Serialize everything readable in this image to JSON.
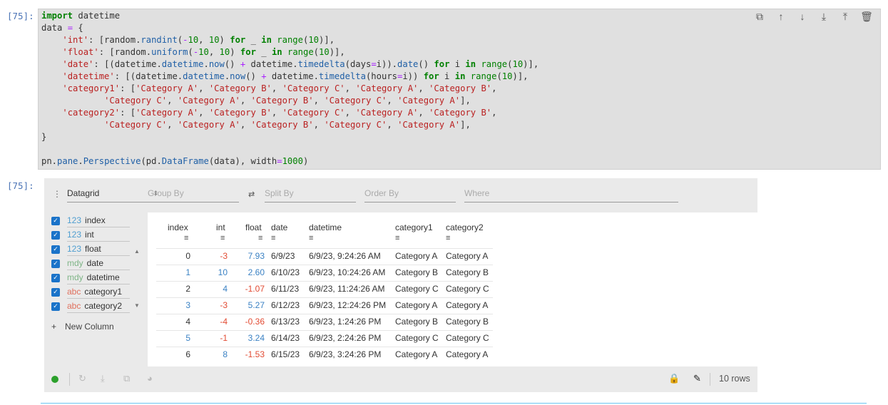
{
  "notebook": {
    "in_prompt": "[75]:",
    "out_prompt": "[75]:",
    "cell_toolbar": [
      {
        "name": "duplicate-icon",
        "glyph": "⧉"
      },
      {
        "name": "move-up-icon",
        "glyph": "↑"
      },
      {
        "name": "move-down-icon",
        "glyph": "↓"
      },
      {
        "name": "insert-below-icon",
        "glyph": "⤓"
      },
      {
        "name": "insert-above-icon",
        "glyph": "⤒"
      },
      {
        "name": "delete-icon",
        "glyph": "🗑"
      }
    ],
    "code_lines": [
      "import datetime",
      "data = {",
      "    'int': [random.randint(-10, 10) for _ in range(10)],",
      "    'float': [random.uniform(-10, 10) for _ in range(10)],",
      "    'date': [(datetime.datetime.now() + datetime.timedelta(days=i)).date() for i in range(10)],",
      "    'datetime': [(datetime.datetime.now() + datetime.timedelta(hours=i)) for i in range(10)],",
      "    'category1': ['Category A', 'Category B', 'Category C', 'Category A', 'Category B',",
      "            'Category C', 'Category A', 'Category B', 'Category C', 'Category A'],",
      "    'category2': ['Category A', 'Category B', 'Category C', 'Category A', 'Category B',",
      "            'Category C', 'Category A', 'Category B', 'Category C', 'Category A'],",
      "}",
      "",
      "pn.pane.Perspective(pd.DataFrame(data), width=1000)"
    ]
  },
  "perspective": {
    "plugin": "Datagrid",
    "group_by": "Group By",
    "split_by": "Split By",
    "order_by": "Order By",
    "where": "Where",
    "columns": [
      {
        "type": "123",
        "name": "index",
        "type_kind": "num"
      },
      {
        "type": "123",
        "name": "int",
        "type_kind": "num"
      },
      {
        "type": "123",
        "name": "float",
        "type_kind": "num"
      },
      {
        "type": "mdy",
        "name": "date",
        "type_kind": "date"
      },
      {
        "type": "mdy",
        "name": "datetime",
        "type_kind": "date"
      },
      {
        "type": "abc",
        "name": "category1",
        "type_kind": "str"
      },
      {
        "type": "abc",
        "name": "category2",
        "type_kind": "str"
      }
    ],
    "new_column": "New Column",
    "grid_headers": [
      "index",
      "int",
      "float",
      "date",
      "datetime",
      "category1",
      "category2"
    ],
    "menu_glyph": "≡",
    "rows": [
      [
        "0",
        "-3",
        "7.93",
        "6/9/23",
        "6/9/23, 9:24:26 AM",
        "Category A",
        "Category A"
      ],
      [
        "1",
        "10",
        "2.60",
        "6/10/23",
        "6/9/23, 10:24:26 AM",
        "Category B",
        "Category B"
      ],
      [
        "2",
        "4",
        "-1.07",
        "6/11/23",
        "6/9/23, 11:24:26 AM",
        "Category C",
        "Category C"
      ],
      [
        "3",
        "-3",
        "5.27",
        "6/12/23",
        "6/9/23, 12:24:26 PM",
        "Category A",
        "Category A"
      ],
      [
        "4",
        "-4",
        "-0.36",
        "6/13/23",
        "6/9/23, 1:24:26 PM",
        "Category B",
        "Category B"
      ],
      [
        "5",
        "-1",
        "3.24",
        "6/14/23",
        "6/9/23, 2:24:26 PM",
        "Category C",
        "Category C"
      ],
      [
        "6",
        "8",
        "-1.53",
        "6/15/23",
        "6/9/23, 3:24:26 PM",
        "Category A",
        "Category A"
      ]
    ],
    "row_count": "10 rows",
    "colors": {
      "positive": "#3b82c4",
      "negative": "#e24b33",
      "status": "#2ca02c",
      "checkbox": "#1a73c9"
    }
  }
}
